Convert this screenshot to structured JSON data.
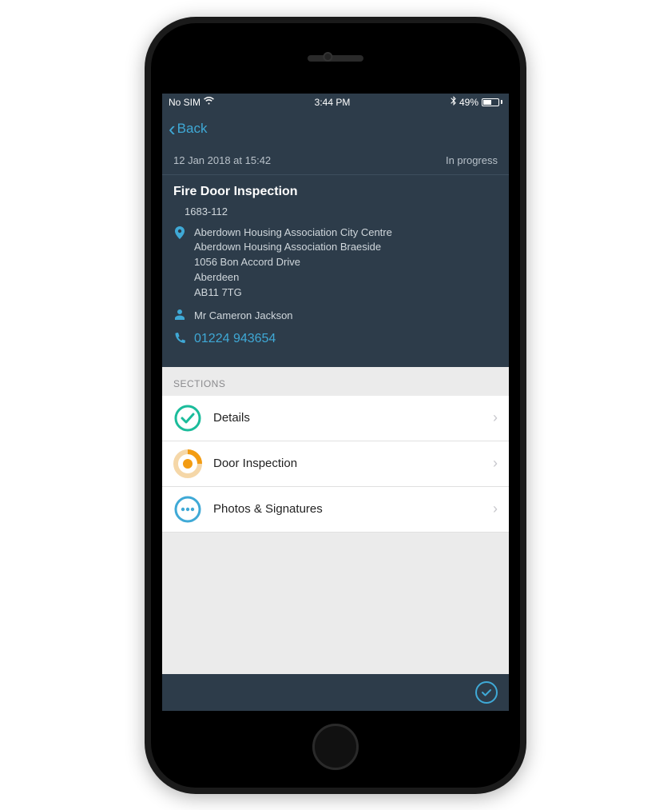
{
  "status_bar": {
    "carrier": "No SIM",
    "time": "3:44 PM",
    "bt": "✱",
    "battery_pct": "49%"
  },
  "nav": {
    "back_label": "Back"
  },
  "meta": {
    "datetime": "12 Jan 2018 at 15:42",
    "status": "In progress"
  },
  "info": {
    "title": "Fire Door Inspection",
    "ref": "1683-112",
    "address_lines": [
      "Aberdown Housing Association City Centre",
      "Aberdown Housing Association Braeside",
      "1056 Bon Accord Drive",
      "Aberdeen",
      "AB11 7TG"
    ],
    "contact": "Mr Cameron Jackson",
    "phone": "01224 943654"
  },
  "sections": {
    "header": "SECTIONS",
    "items": [
      {
        "label": "Details"
      },
      {
        "label": "Door Inspection"
      },
      {
        "label": "Photos & Signatures"
      }
    ]
  }
}
